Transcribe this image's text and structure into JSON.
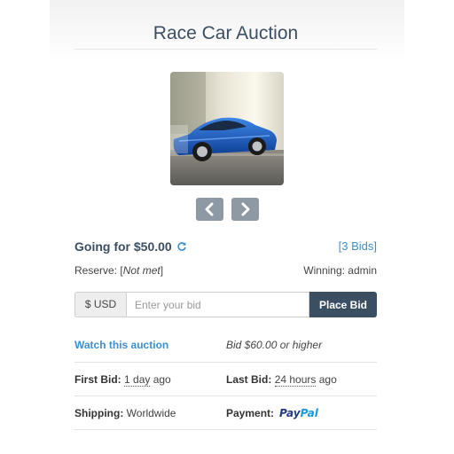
{
  "auction": {
    "title": "Race Car Auction",
    "price_label": "Going for $50.00",
    "bids_label": "[3 Bids]",
    "reserve_prefix": "Reserve: [",
    "reserve_status": "Not met",
    "reserve_suffix": "]",
    "winning": "Winning: admin"
  },
  "bid_form": {
    "currency": "$ USD",
    "placeholder": "Enter your bid",
    "value": "",
    "button_label": "Place Bid"
  },
  "details": {
    "watch_label": "Watch this auction",
    "min_bid": "Bid $60.00 or higher",
    "first_bid_label": "First Bid:",
    "first_bid_value": "1 day",
    "first_bid_suffix": " ago",
    "last_bid_label": "Last Bid:",
    "last_bid_value": "24 hours",
    "last_bid_suffix": " ago",
    "shipping_label": "Shipping:",
    "shipping_value": " Worldwide",
    "payment_label": "Payment:",
    "payment_logo_a": "Pay",
    "payment_logo_b": "Pal"
  },
  "icons": {
    "prev": "chevron-left-icon",
    "next": "chevron-right-icon",
    "refresh": "refresh-icon",
    "payment": "paypal-logo"
  },
  "colors": {
    "primary": "#3b4f63",
    "link": "#3d8fd1",
    "nav_button": "#8d99a4",
    "car": "#1e63c9"
  }
}
